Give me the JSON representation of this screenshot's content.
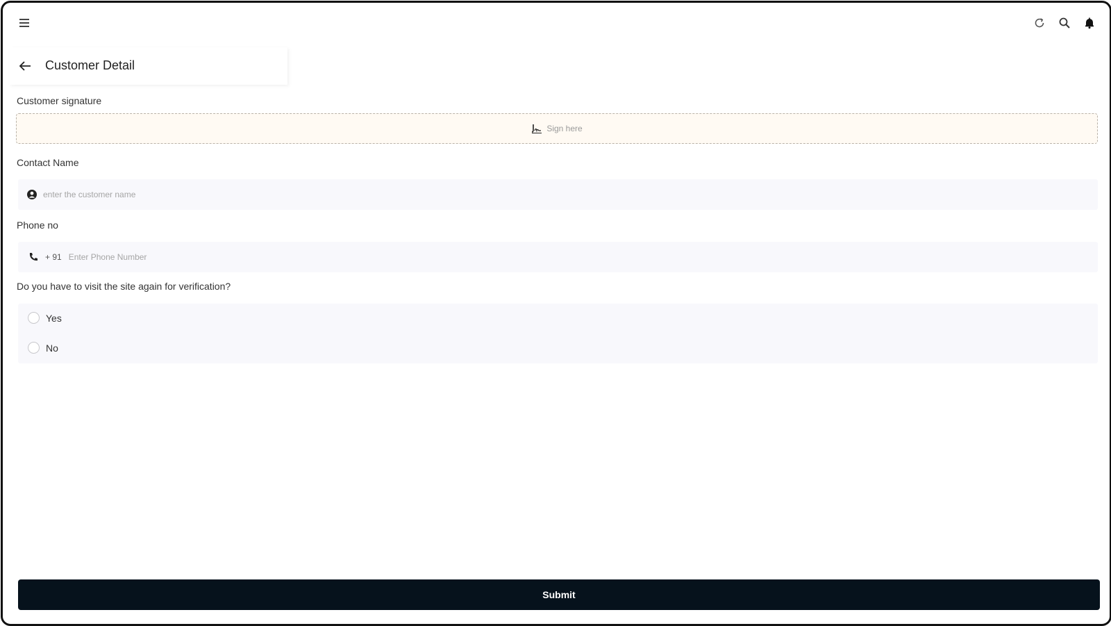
{
  "header": {
    "icons": [
      "menu-icon",
      "sync-icon",
      "search-icon",
      "bell-icon"
    ]
  },
  "page": {
    "title": "Customer Detail",
    "back_icon": "arrow-left-icon"
  },
  "form": {
    "signature": {
      "label": "Customer signature",
      "placeholder": "Sign here",
      "icon": "signature-icon"
    },
    "contact_name": {
      "label": "Contact Name",
      "placeholder": "enter the customer name",
      "value": "",
      "icon": "user-circle-icon"
    },
    "phone": {
      "label": "Phone no",
      "country_code": "+ 91",
      "placeholder": "Enter Phone Number",
      "value": "",
      "icon": "phone-icon"
    },
    "revisit": {
      "question": "Do you  have to visit the site again for verification?",
      "options": [
        "Yes",
        "No"
      ],
      "selected": null
    }
  },
  "actions": {
    "submit_label": "Submit"
  },
  "colors": {
    "submit_bg": "#06121c",
    "signature_bg": "#fffaf3",
    "field_bg": "#f8f8fc"
  }
}
